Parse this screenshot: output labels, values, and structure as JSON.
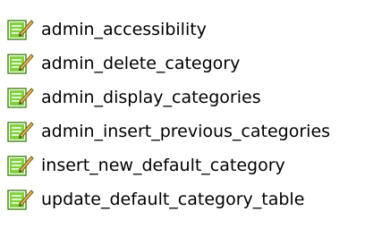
{
  "files": [
    {
      "name": "admin_accessibility",
      "icon": "script-file-edit-icon"
    },
    {
      "name": "admin_delete_category",
      "icon": "script-file-edit-icon"
    },
    {
      "name": "admin_display_categories",
      "icon": "script-file-edit-icon"
    },
    {
      "name": "admin_insert_previous_categories",
      "icon": "script-file-edit-icon"
    },
    {
      "name": "insert_new_default_category",
      "icon": "script-file-edit-icon"
    },
    {
      "name": "update_default_category_table",
      "icon": "script-file-edit-icon"
    }
  ],
  "colors": {
    "icon_fill": "#7fd23a",
    "icon_border": "#4a8c1c",
    "pencil": "#e8c060",
    "text": "#000000"
  }
}
